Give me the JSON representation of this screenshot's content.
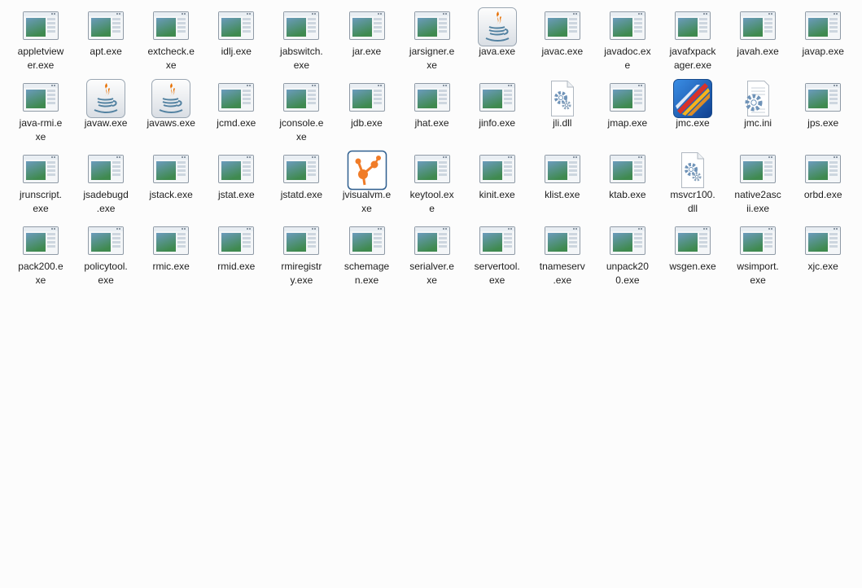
{
  "files": [
    {
      "name": "appletviewer.exe",
      "line1": "appletview",
      "line2": "er.exe",
      "icon": "app-window-icon"
    },
    {
      "name": "apt.exe",
      "line1": "apt.exe",
      "line2": "",
      "icon": "app-window-icon"
    },
    {
      "name": "extcheck.exe",
      "line1": "extcheck.e",
      "line2": "xe",
      "icon": "app-window-icon"
    },
    {
      "name": "idlj.exe",
      "line1": "idlj.exe",
      "line2": "",
      "icon": "app-window-icon"
    },
    {
      "name": "jabswitch.exe",
      "line1": "jabswitch.",
      "line2": "exe",
      "icon": "app-window-icon"
    },
    {
      "name": "jar.exe",
      "line1": "jar.exe",
      "line2": "",
      "icon": "app-window-icon"
    },
    {
      "name": "jarsigner.exe",
      "line1": "jarsigner.e",
      "line2": "xe",
      "icon": "app-window-icon"
    },
    {
      "name": "java.exe",
      "line1": "java.exe",
      "line2": "",
      "icon": "java-cup-icon"
    },
    {
      "name": "javac.exe",
      "line1": "javac.exe",
      "line2": "",
      "icon": "app-window-icon"
    },
    {
      "name": "javadoc.exe",
      "line1": "javadoc.ex",
      "line2": "e",
      "icon": "app-window-icon"
    },
    {
      "name": "javafxpackager.exe",
      "line1": "javafxpack",
      "line2": "ager.exe",
      "icon": "app-window-icon"
    },
    {
      "name": "javah.exe",
      "line1": "javah.exe",
      "line2": "",
      "icon": "app-window-icon"
    },
    {
      "name": "javap.exe",
      "line1": "javap.exe",
      "line2": "",
      "icon": "app-window-icon"
    },
    {
      "name": "java-rmi.exe",
      "line1": "java-rmi.e",
      "line2": "xe",
      "icon": "app-window-icon"
    },
    {
      "name": "javaw.exe",
      "line1": "javaw.exe",
      "line2": "",
      "icon": "java-cup-icon"
    },
    {
      "name": "javaws.exe",
      "line1": "javaws.exe",
      "line2": "",
      "icon": "java-cup-icon"
    },
    {
      "name": "jcmd.exe",
      "line1": "jcmd.exe",
      "line2": "",
      "icon": "app-window-icon"
    },
    {
      "name": "jconsole.exe",
      "line1": "jconsole.e",
      "line2": "xe",
      "icon": "app-window-icon"
    },
    {
      "name": "jdb.exe",
      "line1": "jdb.exe",
      "line2": "",
      "icon": "app-window-icon"
    },
    {
      "name": "jhat.exe",
      "line1": "jhat.exe",
      "line2": "",
      "icon": "app-window-icon"
    },
    {
      "name": "jinfo.exe",
      "line1": "jinfo.exe",
      "line2": "",
      "icon": "app-window-icon"
    },
    {
      "name": "jli.dll",
      "line1": "jli.dll",
      "line2": "",
      "icon": "dll-gear-icon"
    },
    {
      "name": "jmap.exe",
      "line1": "jmap.exe",
      "line2": "",
      "icon": "app-window-icon"
    },
    {
      "name": "jmc.exe",
      "line1": "jmc.exe",
      "line2": "",
      "icon": "mission-control-icon"
    },
    {
      "name": "jmc.ini",
      "line1": "jmc.ini",
      "line2": "",
      "icon": "ini-settings-icon"
    },
    {
      "name": "jps.exe",
      "line1": "jps.exe",
      "line2": "",
      "icon": "app-window-icon"
    },
    {
      "name": "jrunscript.exe",
      "line1": "jrunscript.",
      "line2": "exe",
      "icon": "app-window-icon"
    },
    {
      "name": "jsadebugd.exe",
      "line1": "jsadebugd",
      "line2": ".exe",
      "icon": "app-window-icon"
    },
    {
      "name": "jstack.exe",
      "line1": "jstack.exe",
      "line2": "",
      "icon": "app-window-icon"
    },
    {
      "name": "jstat.exe",
      "line1": "jstat.exe",
      "line2": "",
      "icon": "app-window-icon"
    },
    {
      "name": "jstatd.exe",
      "line1": "jstatd.exe",
      "line2": "",
      "icon": "app-window-icon"
    },
    {
      "name": "jvisualvm.exe",
      "line1": "jvisualvm.e",
      "line2": "xe",
      "icon": "visualvm-icon"
    },
    {
      "name": "keytool.exe",
      "line1": "keytool.ex",
      "line2": "e",
      "icon": "app-window-icon"
    },
    {
      "name": "kinit.exe",
      "line1": "kinit.exe",
      "line2": "",
      "icon": "app-window-icon"
    },
    {
      "name": "klist.exe",
      "line1": "klist.exe",
      "line2": "",
      "icon": "app-window-icon"
    },
    {
      "name": "ktab.exe",
      "line1": "ktab.exe",
      "line2": "",
      "icon": "app-window-icon"
    },
    {
      "name": "msvcr100.dll",
      "line1": "msvcr100.",
      "line2": "dll",
      "icon": "dll-gear-icon"
    },
    {
      "name": "native2ascii.exe",
      "line1": "native2asc",
      "line2": "ii.exe",
      "icon": "app-window-icon"
    },
    {
      "name": "orbd.exe",
      "line1": "orbd.exe",
      "line2": "",
      "icon": "app-window-icon"
    },
    {
      "name": "pack200.exe",
      "line1": "pack200.e",
      "line2": "xe",
      "icon": "app-window-icon"
    },
    {
      "name": "policytool.exe",
      "line1": "policytool.",
      "line2": "exe",
      "icon": "app-window-icon"
    },
    {
      "name": "rmic.exe",
      "line1": "rmic.exe",
      "line2": "",
      "icon": "app-window-icon"
    },
    {
      "name": "rmid.exe",
      "line1": "rmid.exe",
      "line2": "",
      "icon": "app-window-icon"
    },
    {
      "name": "rmiregistry.exe",
      "line1": "rmiregistr",
      "line2": "y.exe",
      "icon": "app-window-icon"
    },
    {
      "name": "schemagen.exe",
      "line1": "schemage",
      "line2": "n.exe",
      "icon": "app-window-icon"
    },
    {
      "name": "serialver.exe",
      "line1": "serialver.e",
      "line2": "xe",
      "icon": "app-window-icon"
    },
    {
      "name": "servertool.exe",
      "line1": "servertool.",
      "line2": "exe",
      "icon": "app-window-icon"
    },
    {
      "name": "tnameserv.exe",
      "line1": "tnameserv",
      "line2": ".exe",
      "icon": "app-window-icon"
    },
    {
      "name": "unpack200.exe",
      "line1": "unpack20",
      "line2": "0.exe",
      "icon": "app-window-icon"
    },
    {
      "name": "wsgen.exe",
      "line1": "wsgen.exe",
      "line2": "",
      "icon": "app-window-icon"
    },
    {
      "name": "wsimport.exe",
      "line1": "wsimport.",
      "line2": "exe",
      "icon": "app-window-icon"
    },
    {
      "name": "xjc.exe",
      "line1": "xjc.exe",
      "line2": "",
      "icon": "app-window-icon"
    }
  ],
  "colors": {
    "background": "#fcfcfc",
    "label": "#1e1e1e",
    "window_frame": "#8f9aa6",
    "window_titlebar": "#e9eef3",
    "window_content_top": "#6b9bbd",
    "window_content_bottom": "#3f8a4f",
    "java_flame": "#e76f00",
    "java_cup": "#5382a1",
    "visualvm_orange": "#f07c28",
    "jmc_blue": "#1f6fc7",
    "jmc_red": "#d8322a",
    "gear_blue": "#6f93b8"
  }
}
